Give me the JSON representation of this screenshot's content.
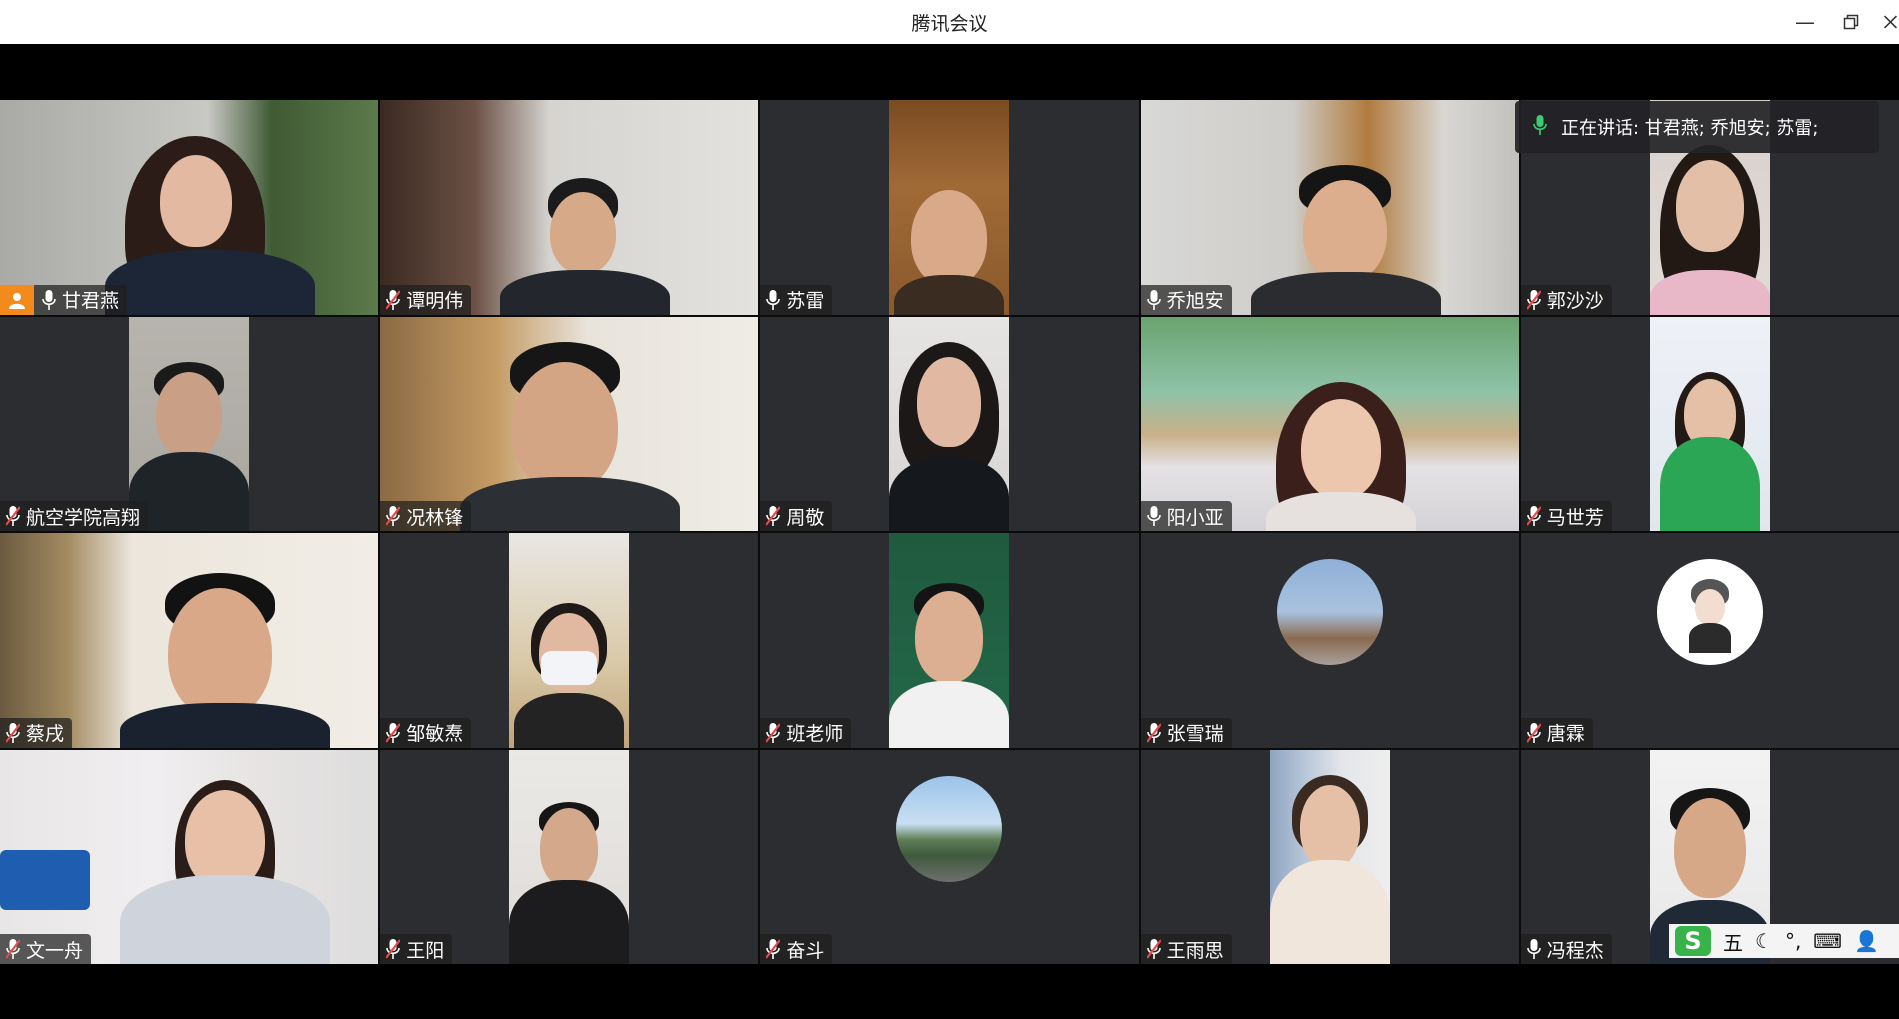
{
  "window": {
    "title": "腾讯会议"
  },
  "speaking": {
    "label": "正在讲话: 甘君燕; 乔旭安; 苏雷;"
  },
  "participants": [
    {
      "name": "甘君燕",
      "mic": "on"
    },
    {
      "name": "谭明伟",
      "mic": "muted"
    },
    {
      "name": "苏雷",
      "mic": "on"
    },
    {
      "name": "乔旭安",
      "mic": "on"
    },
    {
      "name": "郭沙沙",
      "mic": "muted"
    },
    {
      "name": "航空学院高翔",
      "mic": "muted"
    },
    {
      "name": "况林锋",
      "mic": "muted"
    },
    {
      "name": "周敬",
      "mic": "muted"
    },
    {
      "name": "阳小亚",
      "mic": "on"
    },
    {
      "name": "马世芳",
      "mic": "muted"
    },
    {
      "name": "蔡戌",
      "mic": "muted"
    },
    {
      "name": "邹敏焘",
      "mic": "muted"
    },
    {
      "name": "班老师",
      "mic": "muted"
    },
    {
      "name": "张雪瑞",
      "mic": "muted"
    },
    {
      "name": "唐霖",
      "mic": "muted"
    },
    {
      "name": "文一舟",
      "mic": "muted"
    },
    {
      "name": "王阳",
      "mic": "muted"
    },
    {
      "name": "奋斗",
      "mic": "muted"
    },
    {
      "name": "王雨思",
      "mic": "muted"
    },
    {
      "name": "冯程杰",
      "mic": "on"
    }
  ],
  "ime": {
    "mode": "五"
  },
  "colors": {
    "active_speaker_border": "#3ccd72",
    "host_badge": "#f28a1c",
    "tile_bg": "#2b2d31"
  }
}
